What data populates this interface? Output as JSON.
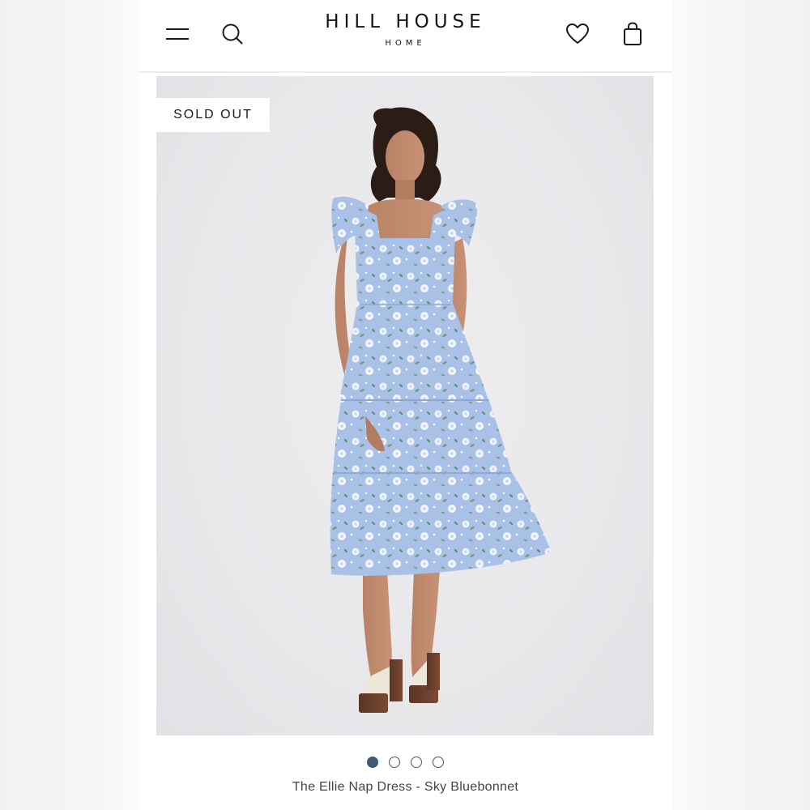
{
  "header": {
    "brand_name": "HILL HOUSE",
    "brand_sub": "HOME",
    "icons": [
      "menu-icon",
      "search-icon",
      "heart-icon",
      "bag-icon"
    ]
  },
  "product": {
    "badge": "SOLD OUT",
    "title": "The Ellie Nap Dress - Sky Bluebonnet",
    "gallery_total": 4,
    "gallery_active": 1,
    "dress_color": "#a9c1e6"
  },
  "colors": {
    "dot_active": "#3f5a73",
    "text_dark": "#141414"
  }
}
